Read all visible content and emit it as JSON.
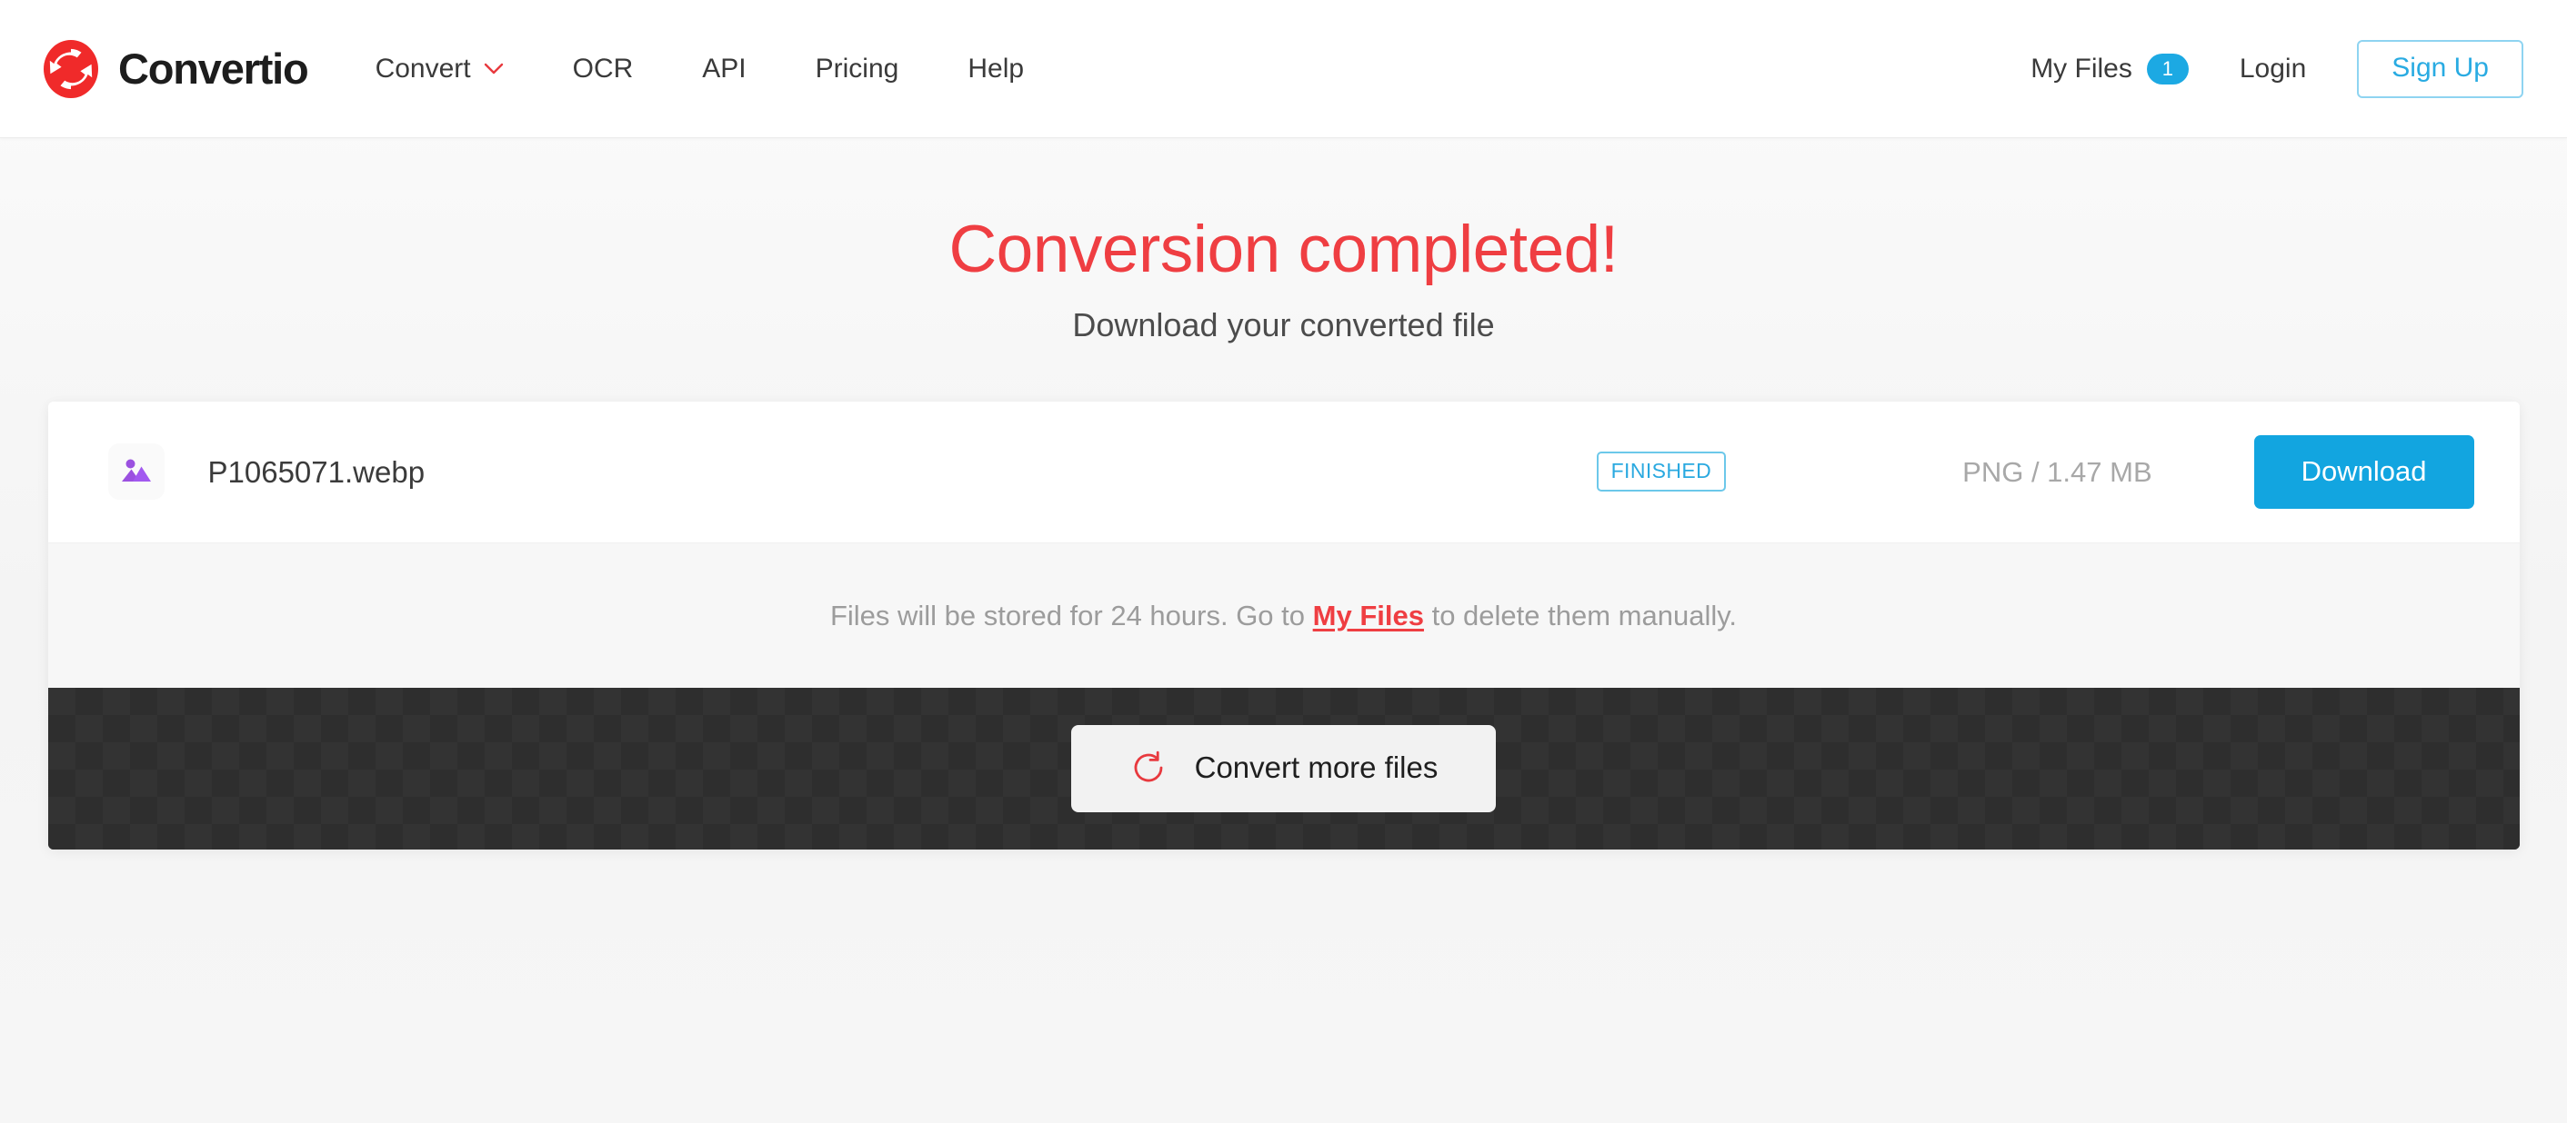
{
  "header": {
    "brand": {
      "name": "Convertio",
      "logo_icon": "convertio-conversion-arrows-logo",
      "logo_color": "#f02a2a"
    },
    "nav": [
      {
        "label": "Convert",
        "has_dropdown": true,
        "dropdown_icon": "chevron-down-icon",
        "dropdown_color": "#e8393e"
      },
      {
        "label": "OCR",
        "has_dropdown": false
      },
      {
        "label": "API",
        "has_dropdown": false
      },
      {
        "label": "Pricing",
        "has_dropdown": false
      },
      {
        "label": "Help",
        "has_dropdown": false
      }
    ],
    "my_files": {
      "label": "My Files",
      "badge_count": "1",
      "badge_color": "#1ca9e3"
    },
    "login": {
      "label": "Login"
    },
    "signup": {
      "label": "Sign Up",
      "border_color": "#8fd4f1",
      "text_color": "#29abe2"
    }
  },
  "main": {
    "title": "Conversion completed!",
    "title_color": "#ef3e42",
    "subtitle": "Download your converted file"
  },
  "file_card": {
    "files": [
      {
        "icon": "image-file-icon",
        "icon_color": "#9b51e0",
        "name": "P1065071.webp",
        "status": "FINISHED",
        "status_color": "#2aa9e0",
        "output_format": "PNG",
        "size": "1.47 MB",
        "meta": "PNG / 1.47 MB",
        "download_label": "Download",
        "download_color": "#12a5e0"
      }
    ],
    "notice": {
      "before_link": "Files will be stored for 24 hours. Go to ",
      "link_label": "My Files",
      "link_color": "#ef3e42",
      "after_link": " to delete them manually."
    },
    "footer": {
      "convert_more_label": "Convert more files",
      "refresh_icon": "refresh-arrow-icon",
      "refresh_icon_color": "#e8393e"
    }
  }
}
